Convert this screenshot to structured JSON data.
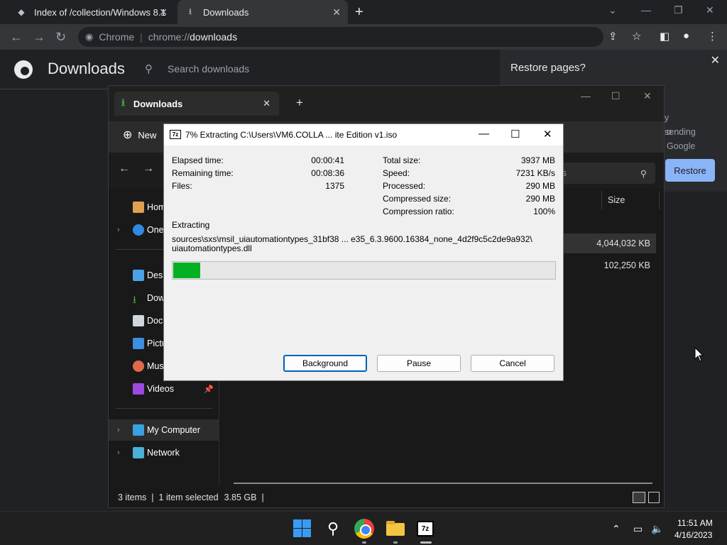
{
  "chrome": {
    "tabs": [
      {
        "label": "Index of /collection/Windows 8.1",
        "icon": "archive-favicon"
      },
      {
        "label": "Downloads",
        "icon": "download-icon"
      }
    ],
    "omnibox": {
      "origin": "Chrome",
      "url_scheme": "chrome://",
      "url_host": "downloads"
    }
  },
  "downloads_page": {
    "title": "Downloads",
    "search_placeholder": "Search downloads"
  },
  "restore_popup": {
    "title": "Restore pages?",
    "body_fragment_1": "y sending",
    "body_fragment_2": "o Google",
    "restore_label": "Restore"
  },
  "explorer": {
    "tab_label": "Downloads",
    "new_label": "New",
    "search_placeholder": "nloads",
    "size_header": "Size",
    "sidebar": [
      {
        "label": "Hom",
        "icon": "home-icon"
      },
      {
        "label": "One",
        "icon": "onedrive-icon"
      },
      {
        "label": "Desk",
        "icon": "desktop-icon"
      },
      {
        "label": "Dow",
        "icon": "downloads-icon"
      },
      {
        "label": "Docu",
        "icon": "documents-icon"
      },
      {
        "label": "Pictu",
        "icon": "pictures-icon"
      },
      {
        "label": "Mus",
        "icon": "music-icon"
      },
      {
        "label": "Videos",
        "icon": "videos-icon"
      },
      {
        "label": "My Computer",
        "icon": "computer-icon"
      },
      {
        "label": "Network",
        "icon": "network-icon"
      }
    ],
    "rows": [
      {
        "size": "4,044,032 KB"
      },
      {
        "size": "102,250 KB"
      }
    ],
    "status": {
      "items": "3 items",
      "selected": "1 item selected",
      "selected_size": "3.85 GB"
    }
  },
  "sevenzip": {
    "title": "7% Extracting C:\\Users\\VM6.COLLA ... ite Edition v1.iso",
    "progress_fraction": 0.07,
    "left_stats": [
      {
        "label": "Elapsed time:",
        "value": "00:00:41"
      },
      {
        "label": "Remaining time:",
        "value": "00:08:36"
      },
      {
        "label": "Files:",
        "value": "1375"
      }
    ],
    "right_stats": [
      {
        "label": "Total size:",
        "value": "3937 MB"
      },
      {
        "label": "Speed:",
        "value": "7231 KB/s"
      },
      {
        "label": "Processed:",
        "value": "290 MB"
      },
      {
        "label": "Compressed size:",
        "value": "290 MB"
      },
      {
        "label": "Compression ratio:",
        "value": "100%"
      }
    ],
    "action_label": "Extracting",
    "path_line1": "sources\\sxs\\msil_uiautomationtypes_31bf38 ... e35_6.3.9600.16384_none_4d2f9c5c2de9a932\\",
    "path_line2": "uiautomationtypes.dll",
    "buttons": {
      "background": "Background",
      "pause": "Pause",
      "cancel": "Cancel"
    }
  },
  "taskbar": {
    "time": "11:51 AM",
    "date": "4/16/2023",
    "apps": [
      "start-icon",
      "search-icon",
      "chrome-icon",
      "file-explorer-icon",
      "7zip-icon"
    ]
  }
}
